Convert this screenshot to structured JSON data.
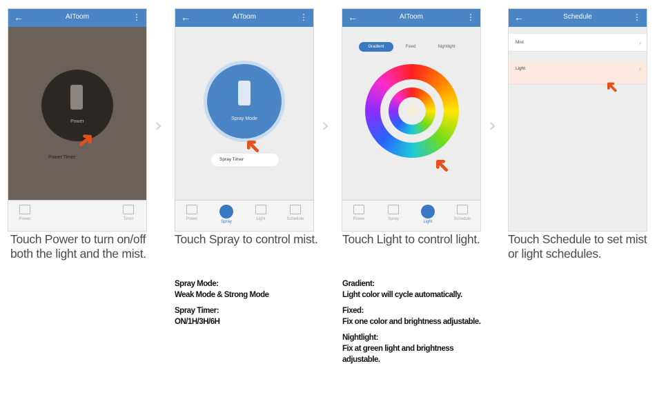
{
  "panels": [
    {
      "app_title": "AIToom",
      "main_label": "Power",
      "small_label": "Power Timer",
      "nav": [
        "Power",
        "Timer"
      ],
      "caption": "Touch Power to turn on/off both the light and the mist."
    },
    {
      "app_title": "AIToom",
      "main_label": "Spray Mode",
      "timer_label": "Spray Timer",
      "nav": [
        "Power",
        "Spray",
        "Light",
        "Schedule"
      ],
      "caption": "Touch Spray to control mist.",
      "details": [
        {
          "title": "Spray Mode:",
          "text": "Weak Mode & Strong Mode"
        },
        {
          "title": "Spray Timer:",
          "text": "ON/1H/3H/6H"
        }
      ]
    },
    {
      "app_title": "AIToom",
      "tabs": [
        "Gradient",
        "Fixed",
        "Nightlight"
      ],
      "nav": [
        "Power",
        "Spray",
        "Light",
        "Schedule"
      ],
      "caption": "Touch Light to control light.",
      "details": [
        {
          "title": "Gradient:",
          "text": "Light color will cycle automatically."
        },
        {
          "title": "Fixed:",
          "text": "Fix one color and brightness adjustable."
        },
        {
          "title": "Nightlight:",
          "text": "Fix at green light and brightness adjustable."
        }
      ]
    },
    {
      "app_title": "Schedule",
      "rows": [
        "Mist",
        "Light"
      ],
      "caption": "Touch Schedule to set mist or light schedules."
    }
  ],
  "colors": {
    "accent": "#4a86c6",
    "arrow": "#e4521c",
    "highlight": "#fde9df"
  }
}
